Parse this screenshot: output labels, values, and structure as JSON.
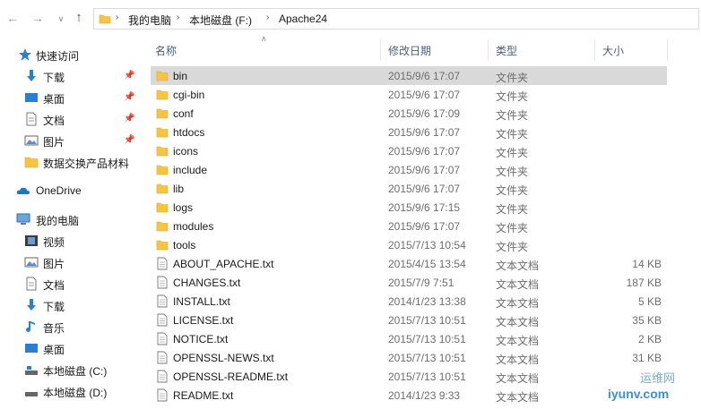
{
  "address_bar": {
    "crumbs": [
      "我的电脑",
      "本地磁盘 (F:)",
      "Apache24"
    ]
  },
  "nav_pane": {
    "quick_access": "快速访问",
    "quick_items": [
      "下载",
      "桌面",
      "文档",
      "图片",
      "数据交换产品材料"
    ],
    "onedrive": "OneDrive",
    "this_pc": "我的电脑",
    "pc_items": [
      "视频",
      "图片",
      "文档",
      "下载",
      "音乐",
      "桌面",
      "本地磁盘 (C:)",
      "本地磁盘 (D:)"
    ]
  },
  "columns": {
    "name": "名称",
    "modified": "修改日期",
    "type": "类型",
    "size": "大小"
  },
  "files": [
    {
      "name": "bin",
      "date": "2015/9/6 17:07",
      "type": "文件夹",
      "size": "",
      "kind": "folder"
    },
    {
      "name": "cgi-bin",
      "date": "2015/9/6 17:07",
      "type": "文件夹",
      "size": "",
      "kind": "folder"
    },
    {
      "name": "conf",
      "date": "2015/9/6 17:09",
      "type": "文件夹",
      "size": "",
      "kind": "folder"
    },
    {
      "name": "htdocs",
      "date": "2015/9/6 17:07",
      "type": "文件夹",
      "size": "",
      "kind": "folder"
    },
    {
      "name": "icons",
      "date": "2015/9/6 17:07",
      "type": "文件夹",
      "size": "",
      "kind": "folder"
    },
    {
      "name": "include",
      "date": "2015/9/6 17:07",
      "type": "文件夹",
      "size": "",
      "kind": "folder"
    },
    {
      "name": "lib",
      "date": "2015/9/6 17:07",
      "type": "文件夹",
      "size": "",
      "kind": "folder"
    },
    {
      "name": "logs",
      "date": "2015/9/6 17:15",
      "type": "文件夹",
      "size": "",
      "kind": "folder"
    },
    {
      "name": "modules",
      "date": "2015/9/6 17:07",
      "type": "文件夹",
      "size": "",
      "kind": "folder"
    },
    {
      "name": "tools",
      "date": "2015/7/13 10:54",
      "type": "文件夹",
      "size": "",
      "kind": "folder"
    },
    {
      "name": "ABOUT_APACHE.txt",
      "date": "2015/4/15 13:54",
      "type": "文本文档",
      "size": "14 KB",
      "kind": "text"
    },
    {
      "name": "CHANGES.txt",
      "date": "2015/7/9 7:51",
      "type": "文本文档",
      "size": "187 KB",
      "kind": "text"
    },
    {
      "name": "INSTALL.txt",
      "date": "2014/1/23 13:38",
      "type": "文本文档",
      "size": "5 KB",
      "kind": "text"
    },
    {
      "name": "LICENSE.txt",
      "date": "2015/7/13 10:51",
      "type": "文本文档",
      "size": "35 KB",
      "kind": "text"
    },
    {
      "name": "NOTICE.txt",
      "date": "2015/7/13 10:51",
      "type": "文本文档",
      "size": "2 KB",
      "kind": "text"
    },
    {
      "name": "OPENSSL-NEWS.txt",
      "date": "2015/7/13 10:51",
      "type": "文本文档",
      "size": "31 KB",
      "kind": "text"
    },
    {
      "name": "OPENSSL-README.txt",
      "date": "2015/7/13 10:51",
      "type": "文本文档",
      "size": "",
      "kind": "text"
    },
    {
      "name": "README.txt",
      "date": "2014/1/23 9:33",
      "type": "文本文档",
      "size": "",
      "kind": "text"
    }
  ],
  "selected_index": 0,
  "watermark": {
    "top": "运维网",
    "bottom": "iyunv.com"
  },
  "colors": {
    "folder": "#f5c542",
    "folder_dark": "#e0a820",
    "selection": "#d9d9d9",
    "header_text": "#4c607a",
    "onedrive": "#1e74c8",
    "pc_blue": "#2a7fd4"
  }
}
